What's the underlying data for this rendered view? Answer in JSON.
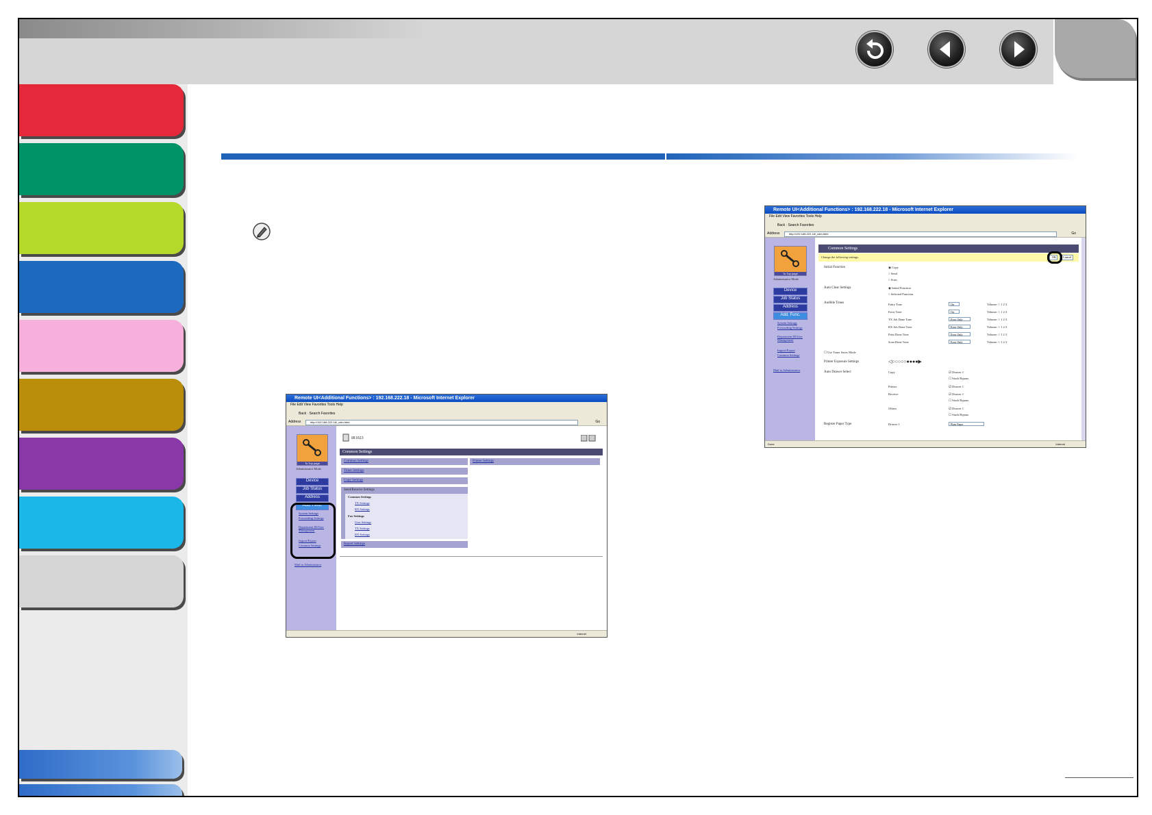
{
  "colors": {
    "tabs": [
      "#e5283a",
      "#009368",
      "#b4d92b",
      "#1d69be",
      "#f7b0dc",
      "#ba8e0b",
      "#8938a8",
      "#1ab7e8",
      "#d5d5d5"
    ],
    "heading_bar": "#1f64b8",
    "topbar": "#d6d6d6"
  },
  "nav": {
    "back_icon": "return-arrow-icon",
    "prev_icon": "left-triangle-icon",
    "next_icon": "right-triangle-icon"
  },
  "note_icon": "pencil-note-icon",
  "screenshot_small": {
    "window_title": "Remote UI<Additional Functions> : 192.168.222.18 - Microsoft Internet Explorer",
    "menu": "File  Edit  View  Favorites  Tools  Help",
    "toolbar": "Back  ·  Search  Favorites",
    "address_label": "Address",
    "address": "http://192.168.222.18/_cdm.html",
    "go": "Go",
    "logo_caption": "To Top page",
    "mode": "Administrator Mode",
    "nav_buttons": [
      "Device",
      "Job Status",
      "Address",
      "Add. Func."
    ],
    "side_links": [
      "System Settings",
      "Forwarding Settings",
      "Department ID/User Management",
      "Import/Export",
      "Common Settings"
    ],
    "mail_link": "Mail to Administrator",
    "device_name": "iR1023",
    "section_title": "Common Settings",
    "left_bars": [
      "Common Settings",
      "Timer Settings",
      "Copy Settings",
      "Send/Receive Settings"
    ],
    "right_bars": [
      "Printer Settings"
    ],
    "send_receive_items": {
      "common_heading": "Common Settings",
      "common": [
        "TX Settings",
        "RX Settings"
      ],
      "fax_heading": "Fax Settings",
      "fax": [
        "User Settings",
        "TX Settings",
        "RX Settings"
      ]
    },
    "report_bar": "Report Settings",
    "status_zone": "Internet"
  },
  "screenshot_large": {
    "window_title": "Remote UI<Additional Functions> : 192.168.222.18 - Microsoft Internet Explorer",
    "menu": "File  Edit  View  Favorites  Tools  Help",
    "toolbar": "Back  ·  Search  Favorites",
    "address_label": "Address",
    "address": "http://192.168.222.18/_cdm.html",
    "go": "Go",
    "logo_caption": "To Top page",
    "mode": "Administrator Mode",
    "nav_buttons": [
      "Device",
      "Job Status",
      "Address",
      "Add. Func."
    ],
    "side_links": [
      "System Settings",
      "Forwarding Settings",
      "Department ID/User Management",
      "Import/Export",
      "Common Settings"
    ],
    "mail_link": "Mail to Administrator",
    "page_title": "Common Settings",
    "change_prompt": "Change the following settings.",
    "ok": "OK",
    "cancel": "Cancel",
    "initial_function_label": "Initial Function",
    "initial_function_options": [
      "Copy",
      "Send",
      "Scan"
    ],
    "auto_clear_label": "Auto Clear Settings",
    "auto_clear_options": [
      "Initial Function",
      "Selected Function"
    ],
    "audible_label": "Audible Tones",
    "tones": [
      {
        "name": "Entry Tone",
        "value": "On"
      },
      {
        "name": "Error Tone",
        "value": "On"
      },
      {
        "name": "TX Job Done Tone",
        "value": "Error Only"
      },
      {
        "name": "RX Job Done Tone",
        "value": "Error Only"
      },
      {
        "name": "Print Done Tone",
        "value": "Error Only"
      },
      {
        "name": "Scan Done Tone",
        "value": "Error Only"
      }
    ],
    "volume_label": "Volume:",
    "volume_levels": "1  2  3",
    "toner_saver": "Use Toner Saver Mode",
    "exposure_label": "Printer Exposure Settings",
    "drawer_select_label": "Auto Drawer Select",
    "drawer_groups": [
      {
        "name": "Copy",
        "options": [
          "Drawer 1",
          "Stack Bypass"
        ]
      },
      {
        "name": "Printer",
        "options": [
          "Drawer 1"
        ]
      },
      {
        "name": "Receive",
        "options": [
          "Drawer 1",
          "Stack Bypass"
        ]
      },
      {
        "name": "Others",
        "options": [
          "Drawer 1",
          "Stack Bypass"
        ]
      }
    ],
    "register_label": "Register Paper Type",
    "register_drawer": "Drawer 1",
    "register_value": "Plain Paper",
    "status_done": "Done",
    "status_zone": "Internet"
  }
}
